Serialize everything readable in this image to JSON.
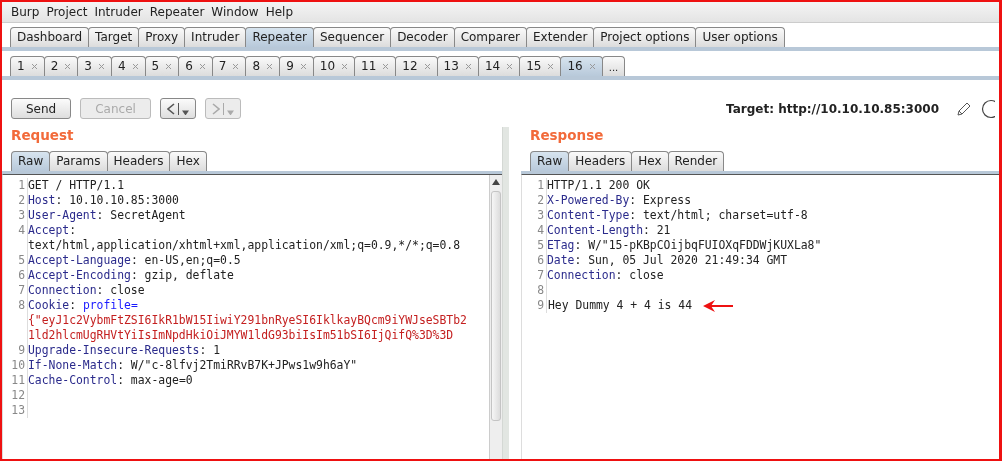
{
  "menu_bar": [
    "Burp",
    "Project",
    "Intruder",
    "Repeater",
    "Window",
    "Help"
  ],
  "main_tabs": [
    {
      "label": "Dashboard",
      "selected": false
    },
    {
      "label": "Target",
      "selected": false
    },
    {
      "label": "Proxy",
      "selected": false
    },
    {
      "label": "Intruder",
      "selected": false
    },
    {
      "label": "Repeater",
      "selected": true
    },
    {
      "label": "Sequencer",
      "selected": false
    },
    {
      "label": "Decoder",
      "selected": false
    },
    {
      "label": "Comparer",
      "selected": false
    },
    {
      "label": "Extender",
      "selected": false
    },
    {
      "label": "Project options",
      "selected": false
    },
    {
      "label": "User options",
      "selected": false
    }
  ],
  "repeater_tabs": [
    {
      "label": "1",
      "selected": false
    },
    {
      "label": "2",
      "selected": false
    },
    {
      "label": "3",
      "selected": false
    },
    {
      "label": "4",
      "selected": false
    },
    {
      "label": "5",
      "selected": false
    },
    {
      "label": "6",
      "selected": false
    },
    {
      "label": "7",
      "selected": false
    },
    {
      "label": "8",
      "selected": false
    },
    {
      "label": "9",
      "selected": false
    },
    {
      "label": "10",
      "selected": false
    },
    {
      "label": "11",
      "selected": false
    },
    {
      "label": "12",
      "selected": false
    },
    {
      "label": "13",
      "selected": false
    },
    {
      "label": "14",
      "selected": false
    },
    {
      "label": "15",
      "selected": false
    },
    {
      "label": "16",
      "selected": true
    }
  ],
  "more_tab": "...",
  "toolbar": {
    "buttons": [
      {
        "label": "Send",
        "disabled": false
      },
      {
        "label": "Cancel",
        "disabled": true
      }
    ],
    "history": [
      {
        "kind": "back",
        "disabled": false
      },
      {
        "kind": "forward",
        "disabled": true
      }
    ],
    "target": "Target: http://10.10.10.85:3000"
  },
  "request": {
    "title": "Request",
    "tabs": [
      {
        "label": "Raw",
        "selected": true
      },
      {
        "label": "Params",
        "selected": false
      },
      {
        "label": "Headers",
        "selected": false
      },
      {
        "label": "Hex",
        "selected": false
      }
    ],
    "lines": [
      {
        "number": "1",
        "segments": [
          {
            "kind": "text",
            "text": "GET / HTTP/1.1"
          }
        ]
      },
      {
        "number": "2",
        "segments": [
          {
            "kind": "name",
            "text": "Host"
          },
          {
            "kind": "text",
            "text": ": 10.10.10.85:3000"
          }
        ]
      },
      {
        "number": "3",
        "segments": [
          {
            "kind": "name",
            "text": "User-Agent"
          },
          {
            "kind": "text",
            "text": ": SecretAgent"
          }
        ]
      },
      {
        "number": "4",
        "segments": [
          {
            "kind": "name",
            "text": "Accept"
          },
          {
            "kind": "text",
            "text": ": text/html,application/xhtml+xml,application/xml;q=0.9,*/*;q=0.8"
          }
        ]
      },
      {
        "number": "5",
        "segments": [
          {
            "kind": "name",
            "text": "Accept-Language"
          },
          {
            "kind": "text",
            "text": ": en-US,en;q=0.5"
          }
        ]
      },
      {
        "number": "6",
        "segments": [
          {
            "kind": "name",
            "text": "Accept-Encoding"
          },
          {
            "kind": "text",
            "text": ": gzip, deflate"
          }
        ]
      },
      {
        "number": "7",
        "segments": [
          {
            "kind": "name",
            "text": "Connection"
          },
          {
            "kind": "text",
            "text": ": close"
          }
        ]
      },
      {
        "number": "8",
        "segments": [
          {
            "kind": "name",
            "text": "Cookie"
          },
          {
            "kind": "text",
            "text": ": "
          },
          {
            "kind": "param_name",
            "text": "profile="
          },
          {
            "kind": "param_value",
            "text": " {\"eyJ1c2VybmFtZSI6IkR1bW15IiwiY291bnRyeSI6IklkayBQcm9iYWJseSBTb21ld2hlcmUgRHVtYiIsImNpdHkiOiJMYW1ldG93biIsIm51bSI6IjQifQ%3D%3D"
          }
        ]
      },
      {
        "number": "9",
        "segments": [
          {
            "kind": "name",
            "text": "Upgrade-Insecure-Requests"
          },
          {
            "kind": "text",
            "text": ": 1"
          }
        ]
      },
      {
        "number": "10",
        "segments": [
          {
            "kind": "name",
            "text": "If-None-Match"
          },
          {
            "kind": "text",
            "text": ": W/\"c-8lfvj2TmiRRvB7K+JPws1w9h6aY\""
          }
        ]
      },
      {
        "number": "11",
        "segments": [
          {
            "kind": "name",
            "text": "Cache-Control"
          },
          {
            "kind": "text",
            "text": ": max-age=0"
          }
        ]
      },
      {
        "number": "12"
      },
      {
        "number": "13"
      }
    ]
  },
  "response": {
    "title": "Response",
    "tabs": [
      {
        "label": "Raw",
        "selected": true
      },
      {
        "label": "Headers",
        "selected": false
      },
      {
        "label": "Hex",
        "selected": false
      },
      {
        "label": "Render",
        "selected": false
      }
    ],
    "lines": [
      {
        "number": "1",
        "segments": [
          {
            "kind": "text",
            "text": "HTTP/1.1 200 OK"
          }
        ]
      },
      {
        "number": "2",
        "segments": [
          {
            "kind": "name",
            "text": "X-Powered-By"
          },
          {
            "kind": "text",
            "text": ": Express"
          }
        ]
      },
      {
        "number": "3",
        "segments": [
          {
            "kind": "name",
            "text": "Content-Type"
          },
          {
            "kind": "text",
            "text": ": text/html; charset=utf-8"
          }
        ]
      },
      {
        "number": "4",
        "segments": [
          {
            "kind": "name",
            "text": "Content-Length"
          },
          {
            "kind": "text",
            "text": ": 21"
          }
        ]
      },
      {
        "number": "5",
        "segments": [
          {
            "kind": "name",
            "text": "ETag"
          },
          {
            "kind": "text",
            "text": ": W/\"15-pKBpCOijbqFUIOXqFDDWjKUXLa8\""
          }
        ]
      },
      {
        "number": "6",
        "segments": [
          {
            "kind": "name",
            "text": "Date"
          },
          {
            "kind": "text",
            "text": ": Sun, 05 Jul 2020 21:49:34 GMT"
          }
        ]
      },
      {
        "number": "7",
        "segments": [
          {
            "kind": "name",
            "text": "Connection"
          },
          {
            "kind": "text",
            "text": ": close"
          }
        ]
      },
      {
        "number": "8"
      },
      {
        "number": "9",
        "segments": [
          {
            "kind": "text",
            "text": "Hey Dummy 4 + 4 is 44"
          }
        ],
        "annotated": true
      }
    ]
  }
}
